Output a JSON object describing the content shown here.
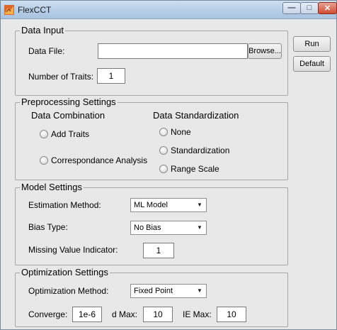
{
  "window": {
    "title": "FlexCCT"
  },
  "buttons": {
    "run": "Run",
    "default": "Default",
    "browse": "Browse..."
  },
  "data_input": {
    "title": "Data Input",
    "data_file_label": "Data File:",
    "data_file_value": "",
    "num_traits_label": "Number of Traits:",
    "num_traits_value": "1"
  },
  "preprocessing": {
    "title": "Preprocessing Settings",
    "combination_title": "Data Combination",
    "combination_options": [
      "Add Traits",
      "Correspondance Analysis"
    ],
    "standardization_title": "Data Standardization",
    "standardization_options": [
      "None",
      "Standardization",
      "Range Scale"
    ]
  },
  "model": {
    "title": "Model Settings",
    "estimation_label": "Estimation Method:",
    "estimation_value": "ML Model",
    "bias_label": "Bias Type:",
    "bias_value": "No Bias",
    "missing_label": "Missing Value Indicator:",
    "missing_value": "1"
  },
  "optimization": {
    "title": "Optimization Settings",
    "method_label": "Optimization Method:",
    "method_value": "Fixed Point",
    "converge_label": "Converge:",
    "converge_value": "1e-6",
    "dmax_label": "d Max:",
    "dmax_value": "10",
    "iemax_label": "IE Max:",
    "iemax_value": "10"
  }
}
